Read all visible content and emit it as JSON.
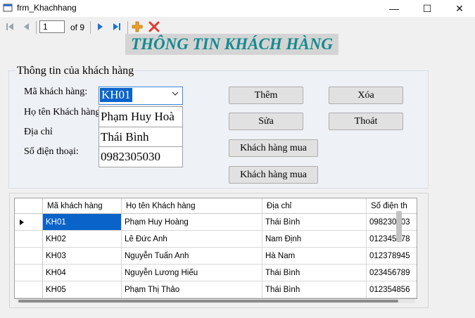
{
  "window": {
    "title": "frm_Khachhang",
    "minimize_label": "—",
    "maximize_label": "☐",
    "close_label": "✕"
  },
  "navigator": {
    "position": "1",
    "count_label": "of 9"
  },
  "header": {
    "title": "THÔNG TIN KHÁCH HÀNG"
  },
  "group": {
    "title": "Thông tin của khách hàng",
    "labels": {
      "ma": "Mã khách hàng:",
      "ten": "Họ tên Khách hàng:",
      "diachi": "Địa chỉ",
      "sdt": "Số điện thoại:"
    },
    "values": {
      "ma": "KH01",
      "ten": "Phạm Huy Hoà",
      "diachi": "Thái Bình",
      "sdt": "0982305030"
    }
  },
  "buttons": {
    "them": "Thêm",
    "xoa": "Xóa",
    "sua": "Sửa",
    "thoat": "Thoát",
    "khmua1": "Khách hàng mua",
    "khmua2": "Khách hàng mua"
  },
  "grid": {
    "columns": [
      "Mã khách hàng",
      "Họ tên Khách hàng",
      "Địa chỉ",
      "Số điện th"
    ],
    "rows": [
      [
        "KH01",
        "Phạm Huy Hoàng",
        "Thái Bình",
        "098230503"
      ],
      [
        "KH02",
        "Lê Đức Anh",
        "Nam Định",
        "012345678"
      ],
      [
        "KH03",
        "Nguyễn Tuấn Anh",
        "Hà Nam",
        "012378945"
      ],
      [
        "KH04",
        "Nguyễn Lương Hiếu",
        "Thái Bình",
        "023456789"
      ],
      [
        "KH05",
        "Phạm Thị Thảo",
        "Thái Bình",
        "012354856"
      ]
    ],
    "selected_row": 0
  },
  "colors": {
    "title_teal": "#138a8f",
    "selection_blue": "#0a63c9",
    "nav_blue": "#1f6fd1",
    "add_orange": "#f0a020",
    "delete_red": "#e23a2a"
  }
}
